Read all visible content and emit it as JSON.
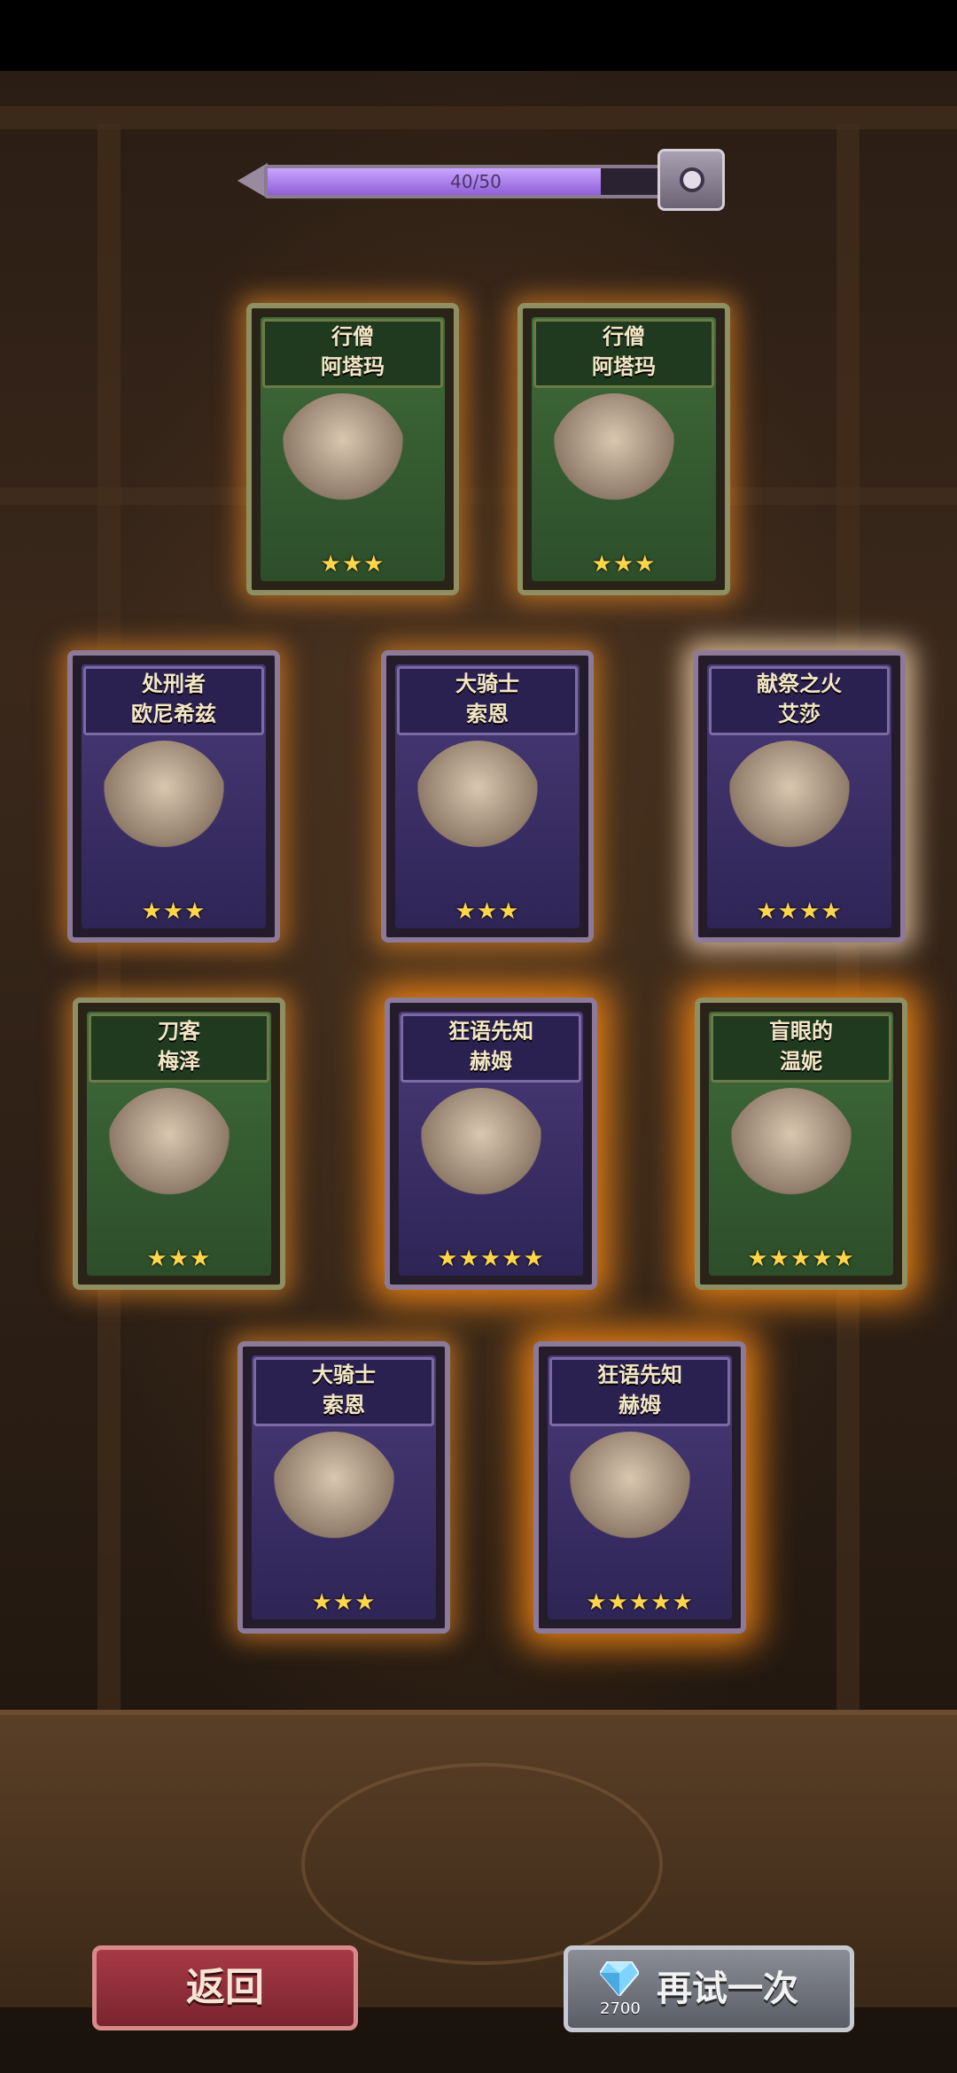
{
  "progress": {
    "text": "40/50",
    "value": 40,
    "max": 50
  },
  "cards": [
    {
      "id": "c1",
      "name_line1": "行僧",
      "name_line2": "阿塔玛",
      "stars": "★★★",
      "star_count": 3,
      "frame": "green"
    },
    {
      "id": "c2",
      "name_line1": "行僧",
      "name_line2": "阿塔玛",
      "stars": "★★★",
      "star_count": 3,
      "frame": "green"
    },
    {
      "id": "c3",
      "name_line1": "处刑者",
      "name_line2": "欧尼希兹",
      "stars": "★★★",
      "star_count": 3,
      "frame": "purple"
    },
    {
      "id": "c4",
      "name_line1": "大骑士",
      "name_line2": "索恩",
      "stars": "★★★",
      "star_count": 3,
      "frame": "purple"
    },
    {
      "id": "c5",
      "name_line1": "献祭之火",
      "name_line2": "艾莎",
      "stars": "★★★★",
      "star_count": 4,
      "frame": "purple"
    },
    {
      "id": "c6",
      "name_line1": "刀客",
      "name_line2": "梅泽",
      "stars": "★★★",
      "star_count": 3,
      "frame": "green"
    },
    {
      "id": "c7",
      "name_line1": "狂语先知",
      "name_line2": "赫姆",
      "stars": "★★★★★",
      "star_count": 5,
      "frame": "purple"
    },
    {
      "id": "c8",
      "name_line1": "盲眼的",
      "name_line2": "温妮",
      "stars": "★★★★★",
      "star_count": 5,
      "frame": "green"
    },
    {
      "id": "c9",
      "name_line1": "大骑士",
      "name_line2": "索恩",
      "stars": "★★★",
      "star_count": 3,
      "frame": "purple"
    },
    {
      "id": "c10",
      "name_line1": "狂语先知",
      "name_line2": "赫姆",
      "stars": "★★★★★",
      "star_count": 5,
      "frame": "purple"
    }
  ],
  "buttons": {
    "back_label": "返回",
    "retry_label": "再试一次",
    "retry_cost": "2700",
    "retry_icon": "diamond-icon"
  },
  "colors": {
    "progress_fill": "#b58cf0",
    "back_button": "#8f2f3a",
    "retry_button": "#72757e",
    "star": "#ffd54a"
  }
}
